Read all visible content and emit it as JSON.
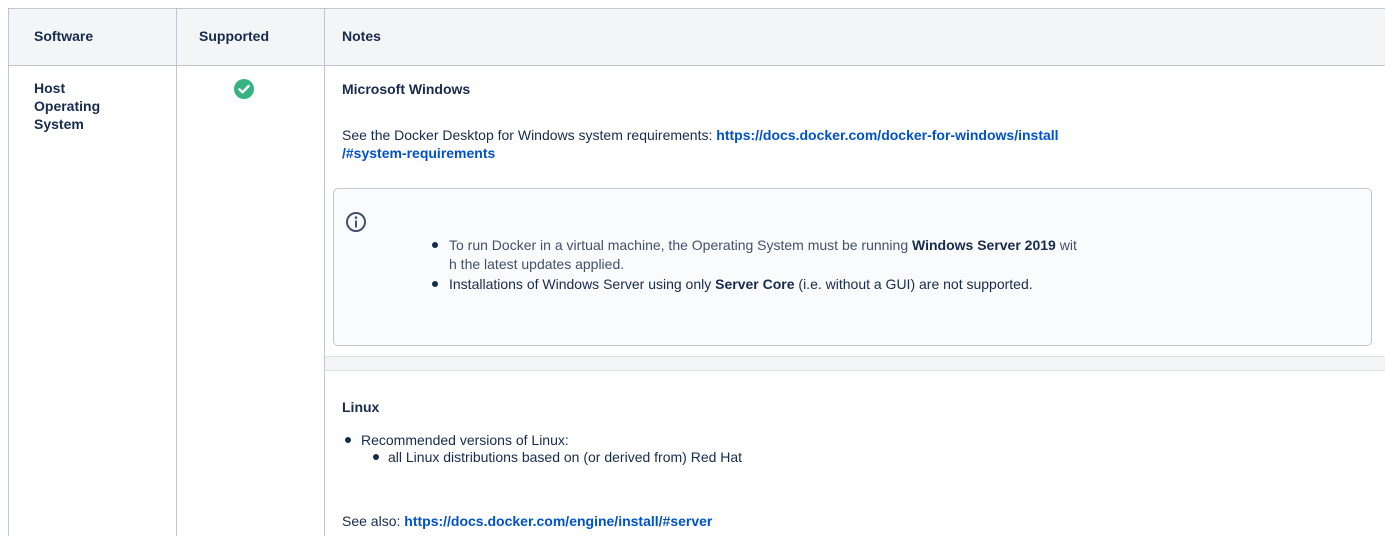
{
  "table": {
    "headers": {
      "software": "Software",
      "supported": "Supported",
      "notes": "Notes"
    },
    "row": {
      "software_line1": "Host",
      "software_line2": "Operating",
      "software_line3": "System",
      "supported_status": "supported",
      "windows": {
        "heading": "Microsoft Windows",
        "req_prefix": "See the Docker Desktop for Windows system requirements: ",
        "req_link_line1": "https://docs.docker.com/docker-for-windows/install",
        "req_link_line2": "/#system-requirements",
        "info": {
          "bullet1_pre": "To run Docker in a virtual machine, the Operating System must be running ",
          "bullet1_bold": "Windows Server 2019",
          "bullet1_post1": " wit",
          "bullet1_post2": "h the latest updates applied.",
          "bullet2_pre": "Installations of Windows Server using only ",
          "bullet2_bold": "Server Core",
          "bullet2_post": " (i.e. without a GUI) are not supported."
        }
      },
      "linux": {
        "heading": "Linux",
        "item1": "Recommended versions of Linux:",
        "subitem1": "all Linux distributions based on (or derived from) Red Hat",
        "see_also_prefix": "See also: ",
        "see_also_link": "https://docs.docker.com/engine/install/#server"
      }
    }
  },
  "colors": {
    "border": "#c1c7d0",
    "header_bg": "#f4f5f7",
    "link": "#0052cc",
    "check": "#36b37e",
    "text": "#172b4d"
  },
  "icons": {
    "supported": "check-circle-icon",
    "info": "info-icon"
  }
}
